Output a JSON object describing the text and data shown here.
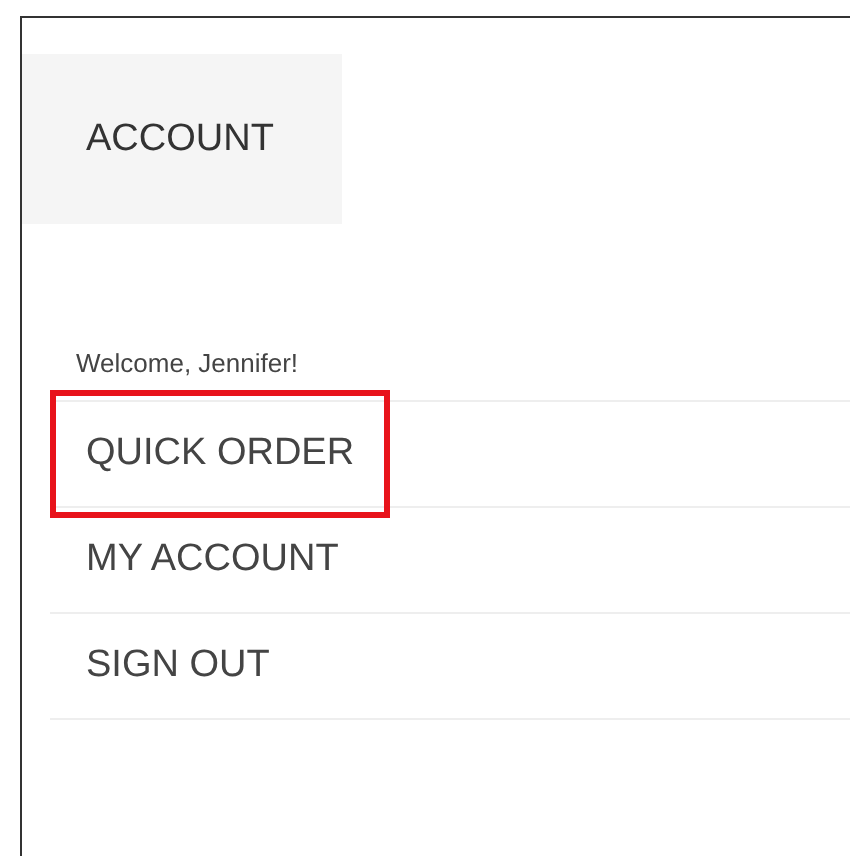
{
  "tab": {
    "label": "ACCOUNT"
  },
  "welcome": "Welcome, Jennifer!",
  "menu": [
    {
      "label": "QUICK ORDER",
      "highlighted": true
    },
    {
      "label": "MY ACCOUNT",
      "highlighted": false
    },
    {
      "label": "SIGN OUT",
      "highlighted": false
    }
  ]
}
